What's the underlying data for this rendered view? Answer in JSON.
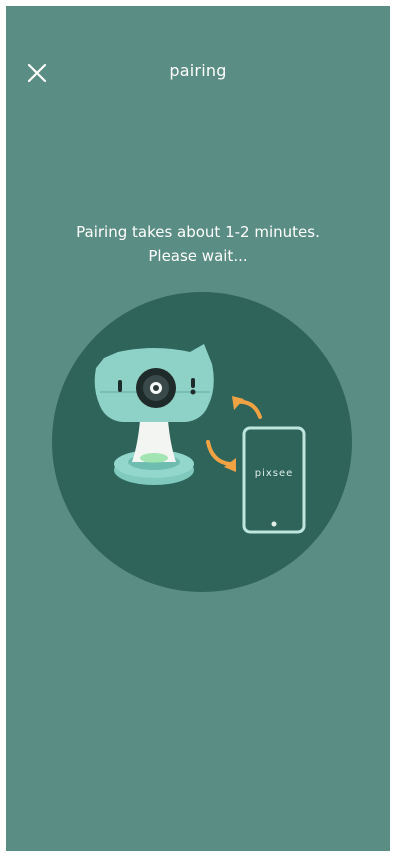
{
  "header": {
    "title": "pairing",
    "close_icon": "close-icon"
  },
  "message": {
    "line1": "Pairing takes about 1-2 minutes.",
    "line2": "Please wait..."
  },
  "illustration": {
    "phone_brand": "pixsee",
    "icons": [
      "camera-icon",
      "phone-icon",
      "arrow-icon"
    ]
  },
  "colors": {
    "background": "#5a8d83",
    "circle": "#2f645b",
    "camera_body": "#8ed1c6",
    "arrow": "#f1a344",
    "text": "#ffffff"
  }
}
